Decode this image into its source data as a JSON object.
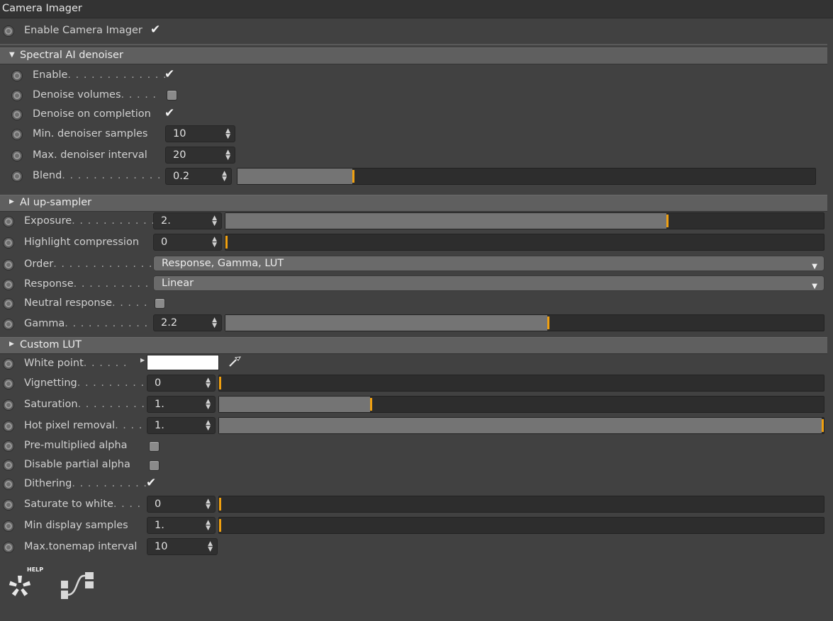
{
  "title": "Camera Imager",
  "enable_imager": {
    "label": "Enable Camera Imager",
    "checked": true
  },
  "sections": {
    "denoiser": "Spectral AI denoiser",
    "upsampler": "AI up-sampler",
    "lut": "Custom LUT"
  },
  "denoiser": {
    "enable": {
      "label": "Enable",
      "dots": ". . . . . . . . . . . . ."
    },
    "denoise_volumes": {
      "label": "Denoise volumes",
      "dots": ". . . . ."
    },
    "denoise_on_completion": {
      "label": "Denoise on completion"
    },
    "min_samples": {
      "label": "Min. denoiser samples",
      "value": "10"
    },
    "max_interval": {
      "label": "Max. denoiser interval",
      "value": "20"
    },
    "blend": {
      "label": "Blend",
      "dots": ". . . . . . . . . . . . . . .",
      "value": "0.2",
      "level": 0.2
    }
  },
  "imager": {
    "exposure": {
      "label": "Exposure",
      "dots": ". . . . . . . . . . . .",
      "value": "2.",
      "level": 0.74
    },
    "highlight": {
      "label": "Highlight compression",
      "value": "0",
      "level": 0
    },
    "order": {
      "label": "Order",
      "dots": ". . . . . . . . . . . . . .",
      "value": "Response, Gamma, LUT"
    },
    "response": {
      "label": "Response",
      "dots": ". . . . . . . . . . .",
      "value": "Linear"
    },
    "neutral": {
      "label": "Neutral response",
      "dots": ". . . . ."
    },
    "gamma": {
      "label": "Gamma",
      "dots": ". . . . . . . . . . . . .",
      "value": "2.2",
      "level": 0.54
    },
    "white_point": {
      "label": "White point",
      "dots": ". . . . . ."
    },
    "vignetting": {
      "label": "Vignetting",
      "dots": ". . . . . . . . .",
      "value": "0",
      "level": 0
    },
    "saturation": {
      "label": "Saturation",
      "dots": ". . . . . . . . .",
      "value": "1.",
      "level": 0.25
    },
    "hot_pixel": {
      "label": "Hot pixel removal",
      "dots": ". . . .",
      "value": "1.",
      "level": 1.0
    },
    "premultiplied": {
      "label": "Pre-multiplied alpha"
    },
    "disable_partial": {
      "label": "Disable partial alpha"
    },
    "dithering": {
      "label": "Dithering",
      "dots": ". . . . . . . . . ."
    },
    "saturate_white": {
      "label": "Saturate to white",
      "dots": ". . . .",
      "value": "0",
      "level": 0
    },
    "min_display": {
      "label": "Min display samples",
      "value": "1.",
      "level": 0
    },
    "max_tonemap": {
      "label": "Max.tonemap interval",
      "value": "10"
    }
  },
  "help_label": "HELP",
  "colors": {
    "accent": "#f0a010",
    "white_point": "#ffffff"
  }
}
